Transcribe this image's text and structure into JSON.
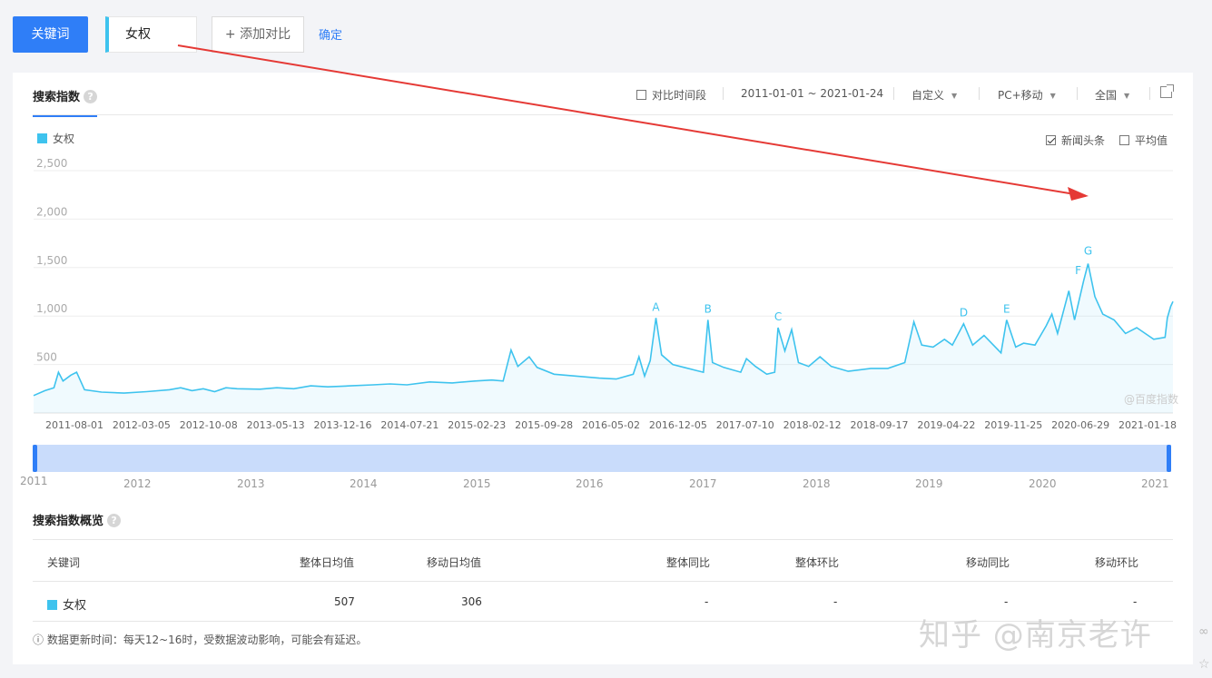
{
  "toolbar": {
    "keyword_button": "关键词",
    "keyword_value": "女权",
    "add_compare": "+ 添加对比",
    "confirm": "确定"
  },
  "panel": {
    "tab_title": "搜索指数",
    "compare_period": "对比时间段",
    "date_range": "2011-01-01 ~ 2021-01-24",
    "custom": "自定义",
    "device": "PC+移动",
    "region": "全国"
  },
  "chart_options": {
    "news_headlines": "新闻头条",
    "news_checked": true,
    "average": "平均值",
    "average_checked": false
  },
  "chart_data": {
    "type": "area",
    "series": [
      {
        "name": "女权",
        "color": "#3ec3ee"
      }
    ],
    "y_ticks": [
      "2,500",
      "2,000",
      "1,500",
      "1,000",
      "500"
    ],
    "y_range": [
      0,
      2500
    ],
    "x_tick_labels": [
      "2011-08-01",
      "2012-03-05",
      "2012-10-08",
      "2013-05-13",
      "2013-12-16",
      "2014-07-21",
      "2015-02-23",
      "2015-09-28",
      "2016-05-02",
      "2016-12-05",
      "2017-07-10",
      "2018-02-12",
      "2018-09-17",
      "2019-04-22",
      "2019-11-25",
      "2020-06-29",
      "2021-01-18"
    ],
    "x_range": [
      2011.0,
      2021.07
    ],
    "points": [
      [
        2011.0,
        180
      ],
      [
        2011.1,
        230
      ],
      [
        2011.18,
        260
      ],
      [
        2011.22,
        420
      ],
      [
        2011.26,
        330
      ],
      [
        2011.33,
        390
      ],
      [
        2011.38,
        420
      ],
      [
        2011.45,
        240
      ],
      [
        2011.6,
        215
      ],
      [
        2011.8,
        205
      ],
      [
        2012.0,
        220
      ],
      [
        2012.2,
        240
      ],
      [
        2012.3,
        260
      ],
      [
        2012.4,
        230
      ],
      [
        2012.5,
        250
      ],
      [
        2012.6,
        220
      ],
      [
        2012.7,
        260
      ],
      [
        2012.8,
        250
      ],
      [
        2013.0,
        245
      ],
      [
        2013.15,
        260
      ],
      [
        2013.3,
        250
      ],
      [
        2013.45,
        280
      ],
      [
        2013.6,
        270
      ],
      [
        2013.8,
        280
      ],
      [
        2014.0,
        290
      ],
      [
        2014.15,
        300
      ],
      [
        2014.3,
        290
      ],
      [
        2014.5,
        320
      ],
      [
        2014.7,
        310
      ],
      [
        2014.9,
        330
      ],
      [
        2015.05,
        340
      ],
      [
        2015.15,
        330
      ],
      [
        2015.22,
        650
      ],
      [
        2015.28,
        480
      ],
      [
        2015.38,
        580
      ],
      [
        2015.45,
        470
      ],
      [
        2015.6,
        400
      ],
      [
        2015.8,
        380
      ],
      [
        2016.0,
        360
      ],
      [
        2016.15,
        350
      ],
      [
        2016.3,
        400
      ],
      [
        2016.35,
        580
      ],
      [
        2016.4,
        380
      ],
      [
        2016.45,
        540
      ],
      [
        2016.5,
        980
      ],
      [
        2016.55,
        600
      ],
      [
        2016.65,
        500
      ],
      [
        2016.75,
        470
      ],
      [
        2016.85,
        440
      ],
      [
        2016.92,
        420
      ],
      [
        2016.96,
        960
      ],
      [
        2017.0,
        520
      ],
      [
        2017.1,
        470
      ],
      [
        2017.25,
        420
      ],
      [
        2017.3,
        560
      ],
      [
        2017.38,
        480
      ],
      [
        2017.48,
        400
      ],
      [
        2017.55,
        420
      ],
      [
        2017.58,
        880
      ],
      [
        2017.64,
        640
      ],
      [
        2017.7,
        860
      ],
      [
        2017.76,
        520
      ],
      [
        2017.85,
        480
      ],
      [
        2017.95,
        580
      ],
      [
        2018.05,
        480
      ],
      [
        2018.2,
        430
      ],
      [
        2018.4,
        460
      ],
      [
        2018.55,
        460
      ],
      [
        2018.7,
        520
      ],
      [
        2018.78,
        940
      ],
      [
        2018.85,
        700
      ],
      [
        2018.95,
        680
      ],
      [
        2019.05,
        760
      ],
      [
        2019.12,
        700
      ],
      [
        2019.22,
        920
      ],
      [
        2019.3,
        700
      ],
      [
        2019.4,
        800
      ],
      [
        2019.55,
        620
      ],
      [
        2019.6,
        960
      ],
      [
        2019.68,
        680
      ],
      [
        2019.75,
        720
      ],
      [
        2019.85,
        700
      ],
      [
        2019.95,
        900
      ],
      [
        2020.0,
        1020
      ],
      [
        2020.05,
        820
      ],
      [
        2020.15,
        1260
      ],
      [
        2020.2,
        960
      ],
      [
        2020.28,
        1360
      ],
      [
        2020.32,
        1540
      ],
      [
        2020.38,
        1200
      ],
      [
        2020.45,
        1020
      ],
      [
        2020.55,
        960
      ],
      [
        2020.65,
        820
      ],
      [
        2020.75,
        880
      ],
      [
        2020.9,
        760
      ],
      [
        2021.0,
        780
      ],
      [
        2021.02,
        980
      ],
      [
        2021.05,
        1100
      ],
      [
        2021.07,
        1150
      ]
    ],
    "annotations": [
      "A",
      "B",
      "C",
      "D",
      "E",
      "F",
      "G"
    ],
    "brand_watermark": "@百度指数",
    "slider_years": [
      "2011",
      "2012",
      "2013",
      "2014",
      "2015",
      "2016",
      "2017",
      "2018",
      "2019",
      "2020",
      "2021"
    ]
  },
  "overview": {
    "title": "搜索指数概览",
    "headers": [
      "关键词",
      "整体日均值",
      "移动日均值",
      "整体同比",
      "整体环比",
      "移动同比",
      "移动环比"
    ],
    "row": [
      "女权",
      "507",
      "306",
      "-",
      "-",
      "-",
      "-"
    ],
    "note": "ⓘ 数据更新时间：每天12~16时，受数据波动影响，可能会有延迟。"
  },
  "watermark": "知乎 @南京老许"
}
